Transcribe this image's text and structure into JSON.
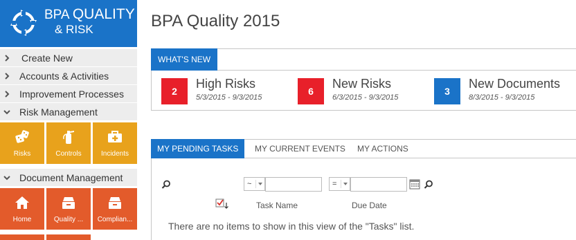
{
  "brand": {
    "line1_lead": "BPA",
    "line1_big": "QUALITY",
    "line2": "& RISK",
    "color": "#1a73c8"
  },
  "sidebar": {
    "items": [
      {
        "label": "Create New"
      },
      {
        "label": "Accounts & Activities"
      },
      {
        "label": "Improvement Processes"
      },
      {
        "label": "Risk Management"
      },
      {
        "label": "Document Management"
      }
    ],
    "risk_tiles": [
      {
        "label": "Risks",
        "icon": "dice-icon"
      },
      {
        "label": "Controls",
        "icon": "fire-extinguisher-icon"
      },
      {
        "label": "Incidents",
        "icon": "first-aid-kit-icon"
      }
    ],
    "doc_tiles": [
      {
        "label": "Home",
        "icon": "home-icon"
      },
      {
        "label": "Quality ...",
        "icon": "archive-box-icon"
      },
      {
        "label": "Complian...",
        "icon": "archive-box-icon"
      }
    ],
    "colors": {
      "risk_tiles": "#e8a21c",
      "doc_tiles": "#e35b2b",
      "nav_bg": "#ededed"
    }
  },
  "main": {
    "title": "BPA Quality 2015",
    "whats_new": {
      "tab_label": "WHAT'S NEW",
      "stats": [
        {
          "count": "2",
          "title": "High Risks",
          "dates": "5/3/2015 - 9/3/2015",
          "color": "#e8202a"
        },
        {
          "count": "6",
          "title": "New Risks",
          "dates": "6/3/2015 - 9/3/2015",
          "color": "#e8202a"
        },
        {
          "count": "3",
          "title": "New Documents",
          "dates": "8/3/2015 - 9/3/2015",
          "color": "#1a73c8"
        }
      ]
    },
    "tasks": {
      "tabs": [
        {
          "label": "MY PENDING TASKS",
          "active": true
        },
        {
          "label": "MY CURRENT EVENTS",
          "active": false
        },
        {
          "label": "MY ACTIONS",
          "active": false
        }
      ],
      "filter1_operator": "~",
      "filter1_value": "",
      "filter2_operator": "=",
      "filter2_value": "",
      "columns": [
        "Task Name",
        "Due Date"
      ],
      "empty_message": "There are no items to show in this view of the \"Tasks\" list."
    }
  }
}
